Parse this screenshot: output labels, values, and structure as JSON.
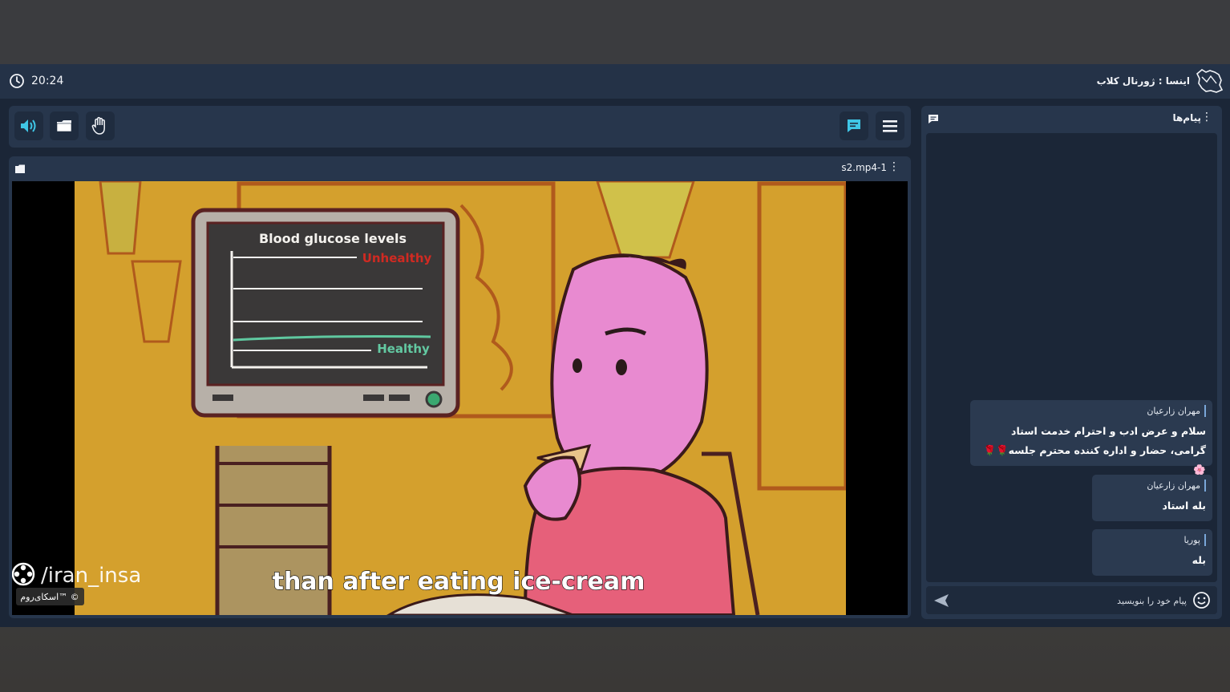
{
  "header": {
    "clock": "20:24",
    "title": "اینسا : ژورنال کلاب"
  },
  "toolbar": {
    "left_icons": [
      "speaker-icon",
      "folder-icon",
      "hand-icon"
    ],
    "right_icons": [
      "chat-icon",
      "menu-icon"
    ]
  },
  "video_panel": {
    "title": "s2.mp4-1",
    "chart_title": "Blood glucose levels",
    "label_unhealthy": "Unhealthy",
    "label_healthy": "Healthy",
    "subtitle": "than after eating ice-cream",
    "watermark": "/iran_insa",
    "brand_badge": "اسکای‌روم™ ©"
  },
  "chat": {
    "title": "پیام‌ها",
    "messages": [
      {
        "author": "مهران زارعیان",
        "text": "سلام و عرض ادب و احترام خدمت استاد گرامی، حضار و اداره کننده محترم جلسه🌹🌹🌸"
      },
      {
        "author": "مهران زارعیان",
        "text": "بله استاد"
      },
      {
        "author": "پوریا",
        "text": "بله"
      }
    ],
    "input_placeholder": "پیام خود را بنویسید"
  },
  "colors": {
    "app_bg": "#1b2637",
    "panel_bg": "#27364c",
    "accent_cyan": "#3fc6e6",
    "video_bg": "#d8a531"
  }
}
